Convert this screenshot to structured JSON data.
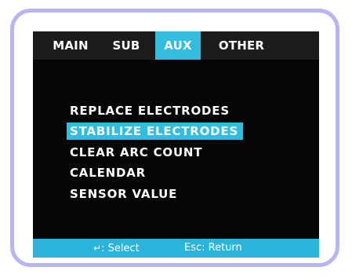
{
  "tabs": [
    {
      "label": "MAIN",
      "active": false
    },
    {
      "label": "SUB",
      "active": false
    },
    {
      "label": "AUX",
      "active": true
    },
    {
      "label": "OTHER",
      "active": false
    }
  ],
  "menu": {
    "items": [
      {
        "label": "REPLACE ELECTRODES",
        "selected": false
      },
      {
        "label": "STABILIZE ELECTRODES",
        "selected": true
      },
      {
        "label": "CLEAR ARC COUNT",
        "selected": false
      },
      {
        "label": "CALENDAR",
        "selected": false
      },
      {
        "label": "SENSOR VALUE",
        "selected": false
      }
    ]
  },
  "statusbar": {
    "select_icon": "enter-arrow-icon",
    "select_icon_glyph": "↵",
    "select_label": ": Select",
    "return_label": "Esc: Return"
  },
  "colors": {
    "accent": "#30bde0",
    "screen_bg": "#060606",
    "frame_border": "#b9b5f2",
    "text": "#ffffff"
  }
}
